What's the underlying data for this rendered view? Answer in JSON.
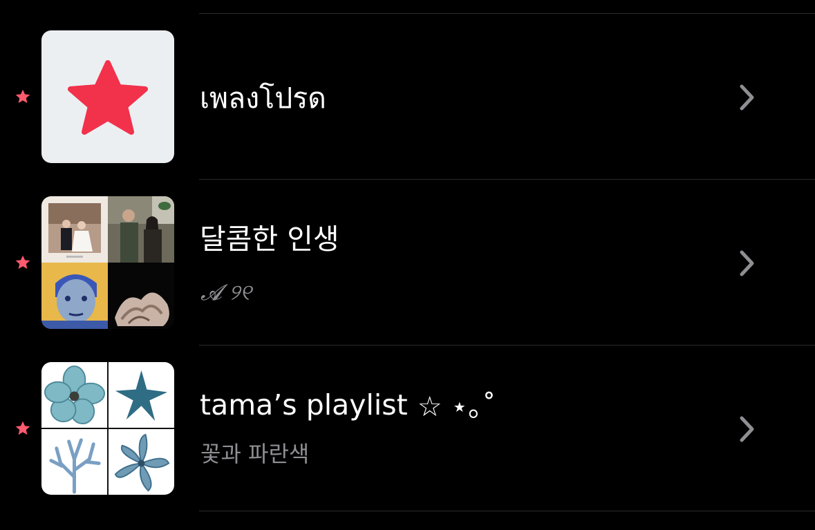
{
  "playlists": [
    {
      "title": "เพลงโปรด",
      "subtitle": "",
      "starred": true,
      "artwork": "favorites-star-artwork"
    },
    {
      "title": "달콤한 인생",
      "subtitle": "𝓐 ୨୧",
      "starred": true,
      "artwork": "photo-collage-artwork"
    },
    {
      "title": "tama’s playlist",
      "title_decoration": "☆ ⋆｡˚",
      "subtitle": "꽃과 파란색",
      "starred": true,
      "artwork": "blue-flowers-collage-artwork"
    }
  ],
  "colors": {
    "background": "#000000",
    "accent_star": "#f2314b",
    "marker_star": "#ff5a6e",
    "subtitle": "#8e8e93",
    "chevron": "#8e8e93",
    "separator": "#2b2b2e"
  },
  "icons": [
    "star-icon",
    "chevron-right-icon"
  ]
}
